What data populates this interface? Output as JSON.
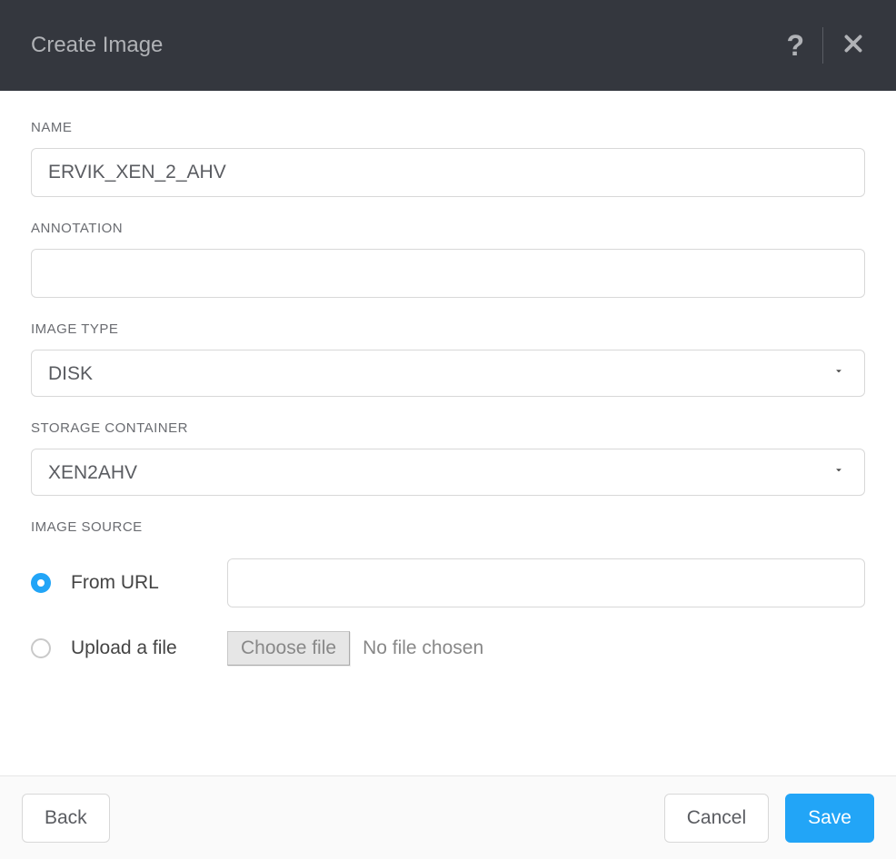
{
  "header": {
    "title": "Create Image"
  },
  "form": {
    "name": {
      "label": "NAME",
      "value": "ERVIK_XEN_2_AHV"
    },
    "annotation": {
      "label": "ANNOTATION",
      "value": ""
    },
    "imageType": {
      "label": "IMAGE TYPE",
      "value": "DISK"
    },
    "storageContainer": {
      "label": "STORAGE CONTAINER",
      "value": "XEN2AHV"
    },
    "imageSource": {
      "label": "IMAGE SOURCE",
      "selected": "url",
      "fromUrlLabel": "From URL",
      "urlValue": "",
      "uploadFileLabel": "Upload a file",
      "chooseFileButton": "Choose file",
      "noFileChosen": "No file chosen"
    }
  },
  "footer": {
    "back": "Back",
    "cancel": "Cancel",
    "save": "Save"
  }
}
